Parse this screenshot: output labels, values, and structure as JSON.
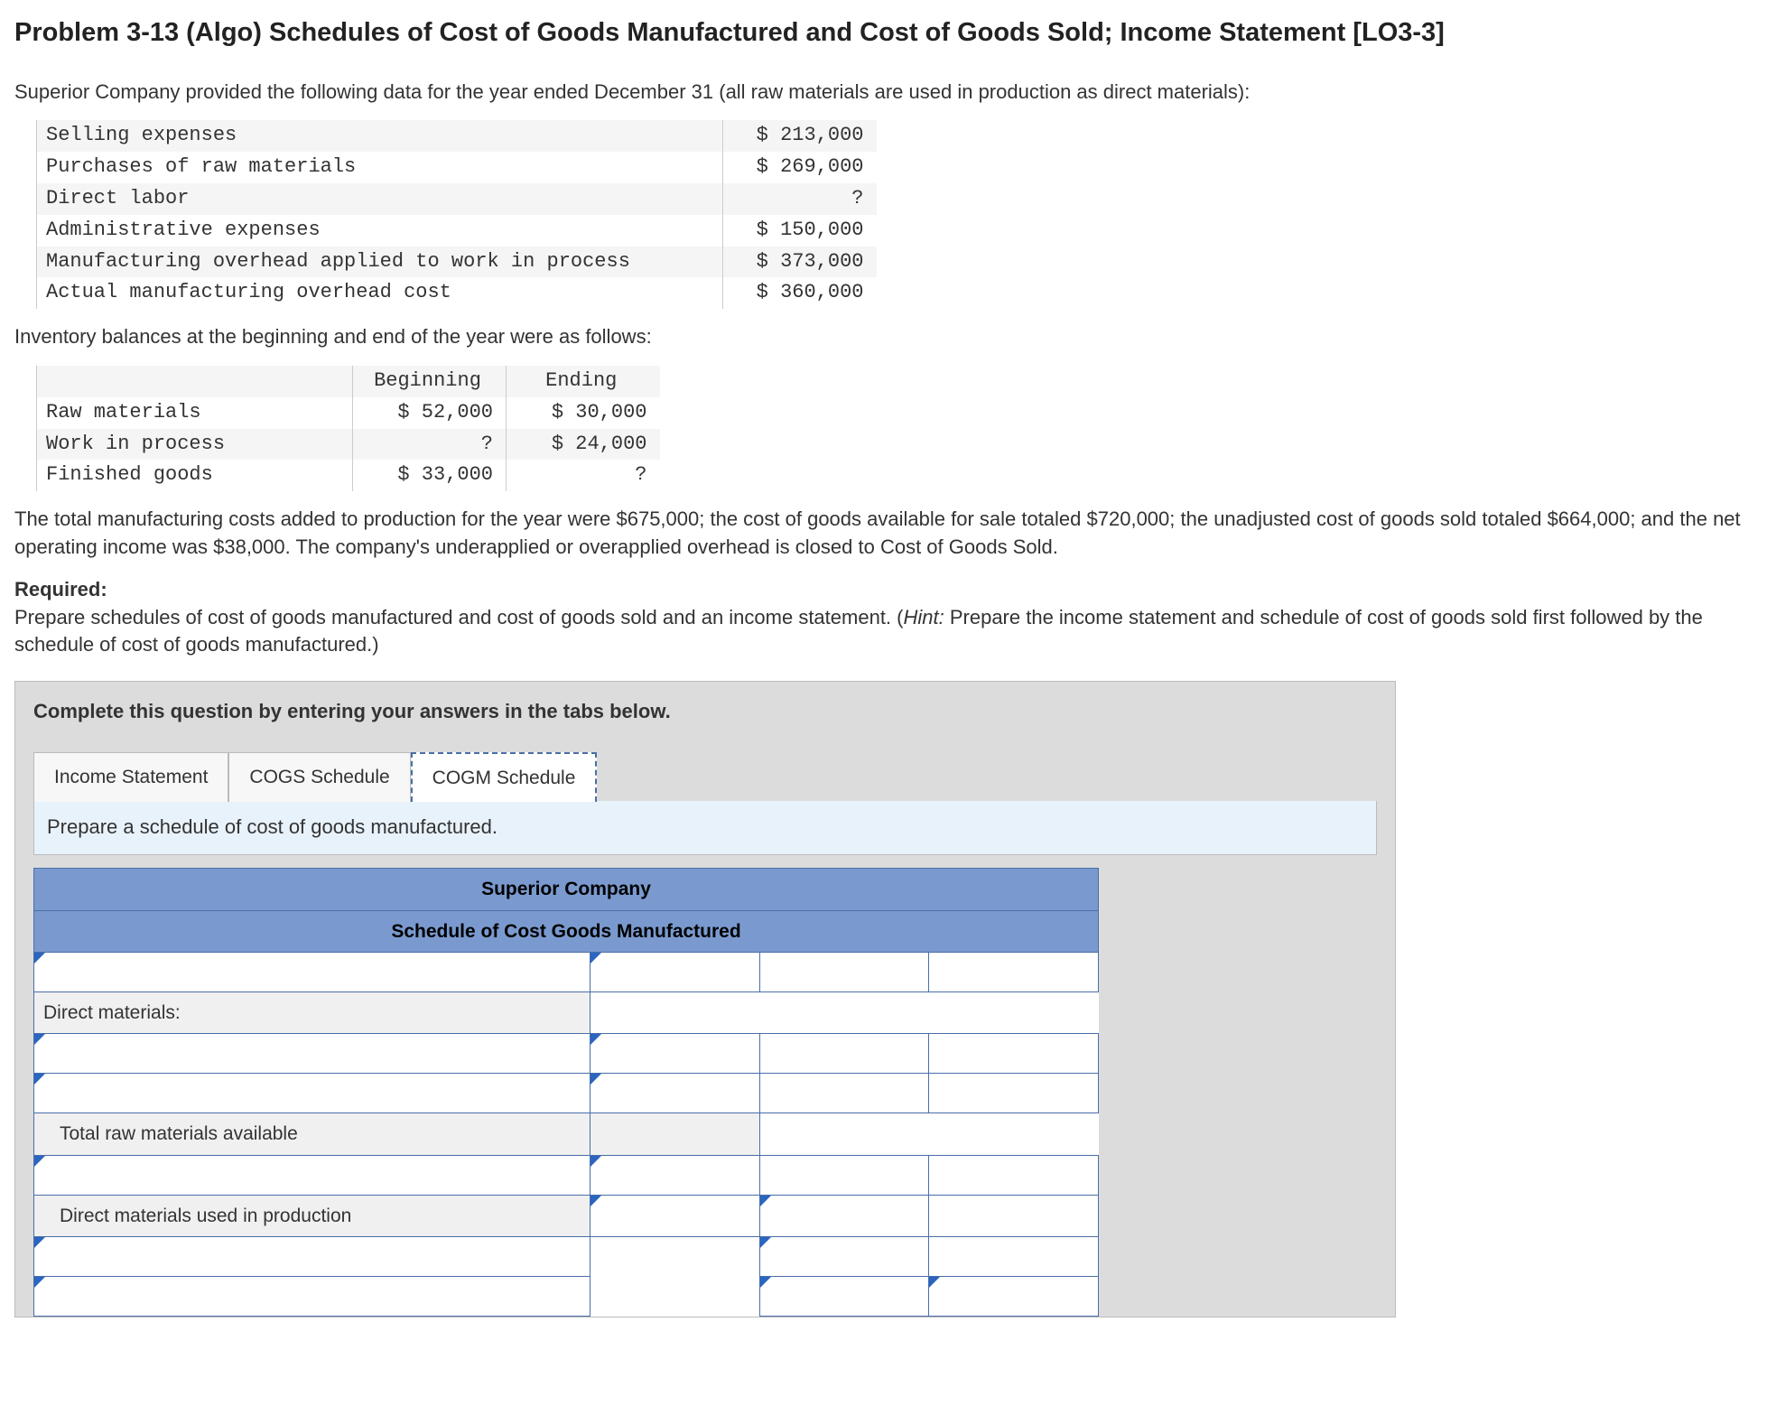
{
  "title": "Problem 3-13 (Algo) Schedules of Cost of Goods Manufactured and Cost of Goods Sold; Income Statement [LO3-3]",
  "intro": "Superior Company provided the following data for the year ended December 31 (all raw materials are used in production as direct materials):",
  "table1": {
    "rows": [
      {
        "label": "Selling expenses",
        "value": "$ 213,000"
      },
      {
        "label": "Purchases of raw materials",
        "value": "$ 269,000"
      },
      {
        "label": "Direct labor",
        "value": "?"
      },
      {
        "label": "Administrative expenses",
        "value": "$ 150,000"
      },
      {
        "label": "Manufacturing overhead applied to work in process",
        "value": "$ 373,000"
      },
      {
        "label": "Actual manufacturing overhead cost",
        "value": "$ 360,000"
      }
    ]
  },
  "inventory_line": "Inventory balances at the beginning and end of the year were as follows:",
  "table2": {
    "headers": [
      "",
      "Beginning",
      "Ending"
    ],
    "rows": [
      {
        "label": "Raw materials",
        "beg": "$ 52,000",
        "end": "$ 30,000"
      },
      {
        "label": "Work in process",
        "beg": "?",
        "end": "$ 24,000"
      },
      {
        "label": "Finished goods",
        "beg": "$ 33,000",
        "end": "?"
      }
    ]
  },
  "para2": "The total manufacturing costs added to production for the year were $675,000; the cost of goods available for sale totaled $720,000; the unadjusted cost of goods sold totaled $664,000; and the net operating income was $38,000. The company's underapplied or overapplied overhead is closed to Cost of Goods Sold.",
  "required_label": "Required:",
  "required_text": "Prepare schedules of cost of goods manufactured and cost of goods sold and an income statement. (",
  "hint_label": "Hint:",
  "required_text2": " Prepare the income statement and schedule of cost of goods sold first followed by the schedule of cost of goods manufactured.)",
  "answer_instr": "Complete this question by entering your answers in the tabs below.",
  "tabs": {
    "income": "Income Statement",
    "cogs": "COGS Schedule",
    "cogm": "COGM Schedule"
  },
  "active_tab_prompt": "Prepare a schedule of cost of goods manufactured.",
  "grid": {
    "company": "Superior Company",
    "title": "Schedule of Cost Goods Manufactured",
    "rows": [
      {
        "label": "",
        "editable": true,
        "cols": [
          "edit",
          "show",
          "show"
        ]
      },
      {
        "label": "Direct materials:",
        "editable": false,
        "cols": [
          "none",
          "none",
          "none"
        ]
      },
      {
        "label": "",
        "editable": true,
        "indent": true,
        "cols": [
          "edit",
          "show",
          "show"
        ]
      },
      {
        "label": "",
        "editable": true,
        "indent": true,
        "cols": [
          "edit",
          "show",
          "show"
        ]
      },
      {
        "label": "Total raw materials available",
        "editable": false,
        "indent": true,
        "cols": [
          "ro",
          "none",
          "none"
        ]
      },
      {
        "label": "",
        "editable": true,
        "indent": true,
        "cols": [
          "edit",
          "show",
          "show"
        ]
      },
      {
        "label": "Direct materials used in production",
        "editable": false,
        "indent": true,
        "cols": [
          "edit",
          "edit",
          "show"
        ]
      },
      {
        "label": "",
        "editable": true,
        "cols": [
          "none",
          "edit",
          "show"
        ]
      },
      {
        "label": "",
        "editable": true,
        "cols": [
          "none",
          "edit",
          "edit"
        ]
      }
    ]
  }
}
